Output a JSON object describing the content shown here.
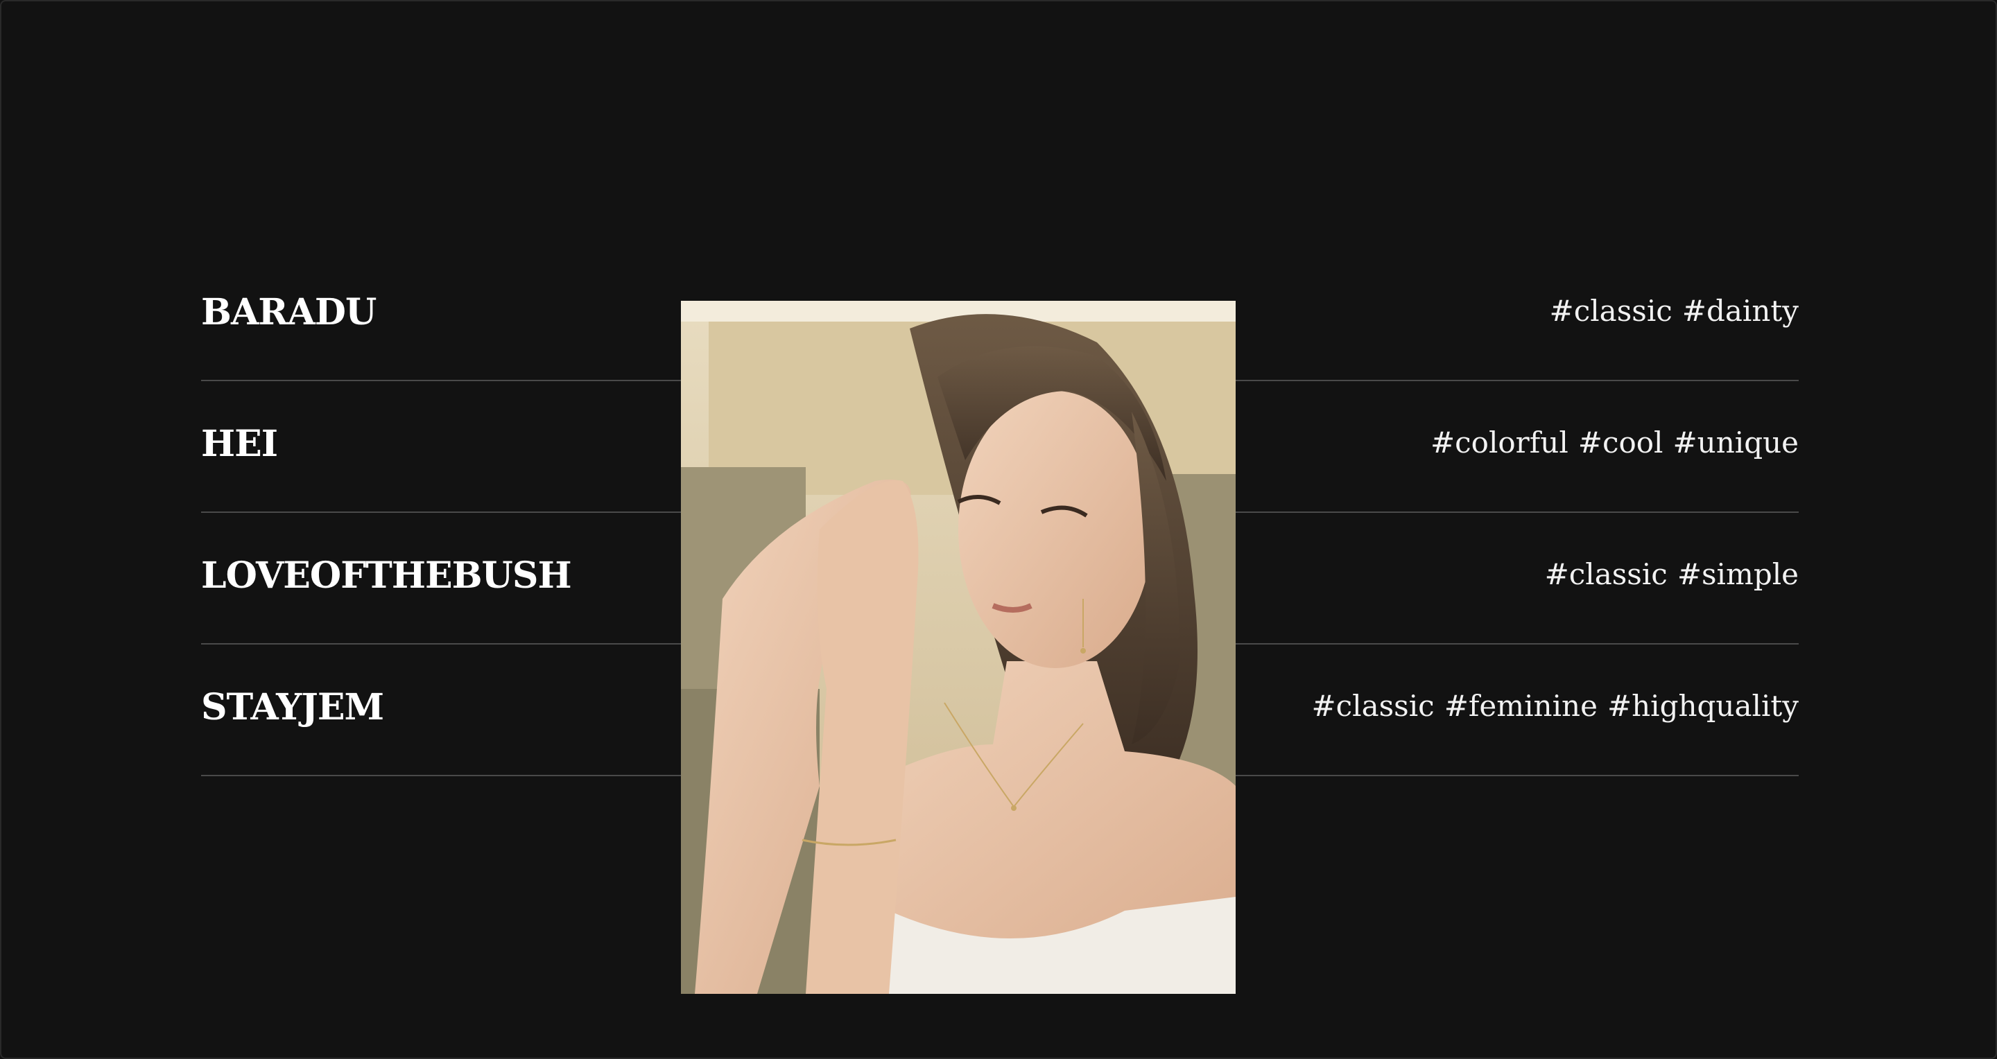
{
  "brands": [
    {
      "name": "BARADU",
      "tags": [
        "#classic",
        "#dainty"
      ]
    },
    {
      "name": "HEI",
      "tags": [
        "#colorful",
        "#cool",
        "#unique"
      ]
    },
    {
      "name": "LOVEOFTHEBUSH",
      "tags": [
        "#classic",
        "#simple"
      ]
    },
    {
      "name": "STAYJEM",
      "tags": [
        "#classic",
        "#feminine",
        "#highquality"
      ]
    }
  ],
  "colors": {
    "background": "#121212",
    "text": "#ffffff",
    "divider": "#4a4a4a"
  },
  "photo": {
    "icon": "portrait-photo"
  }
}
